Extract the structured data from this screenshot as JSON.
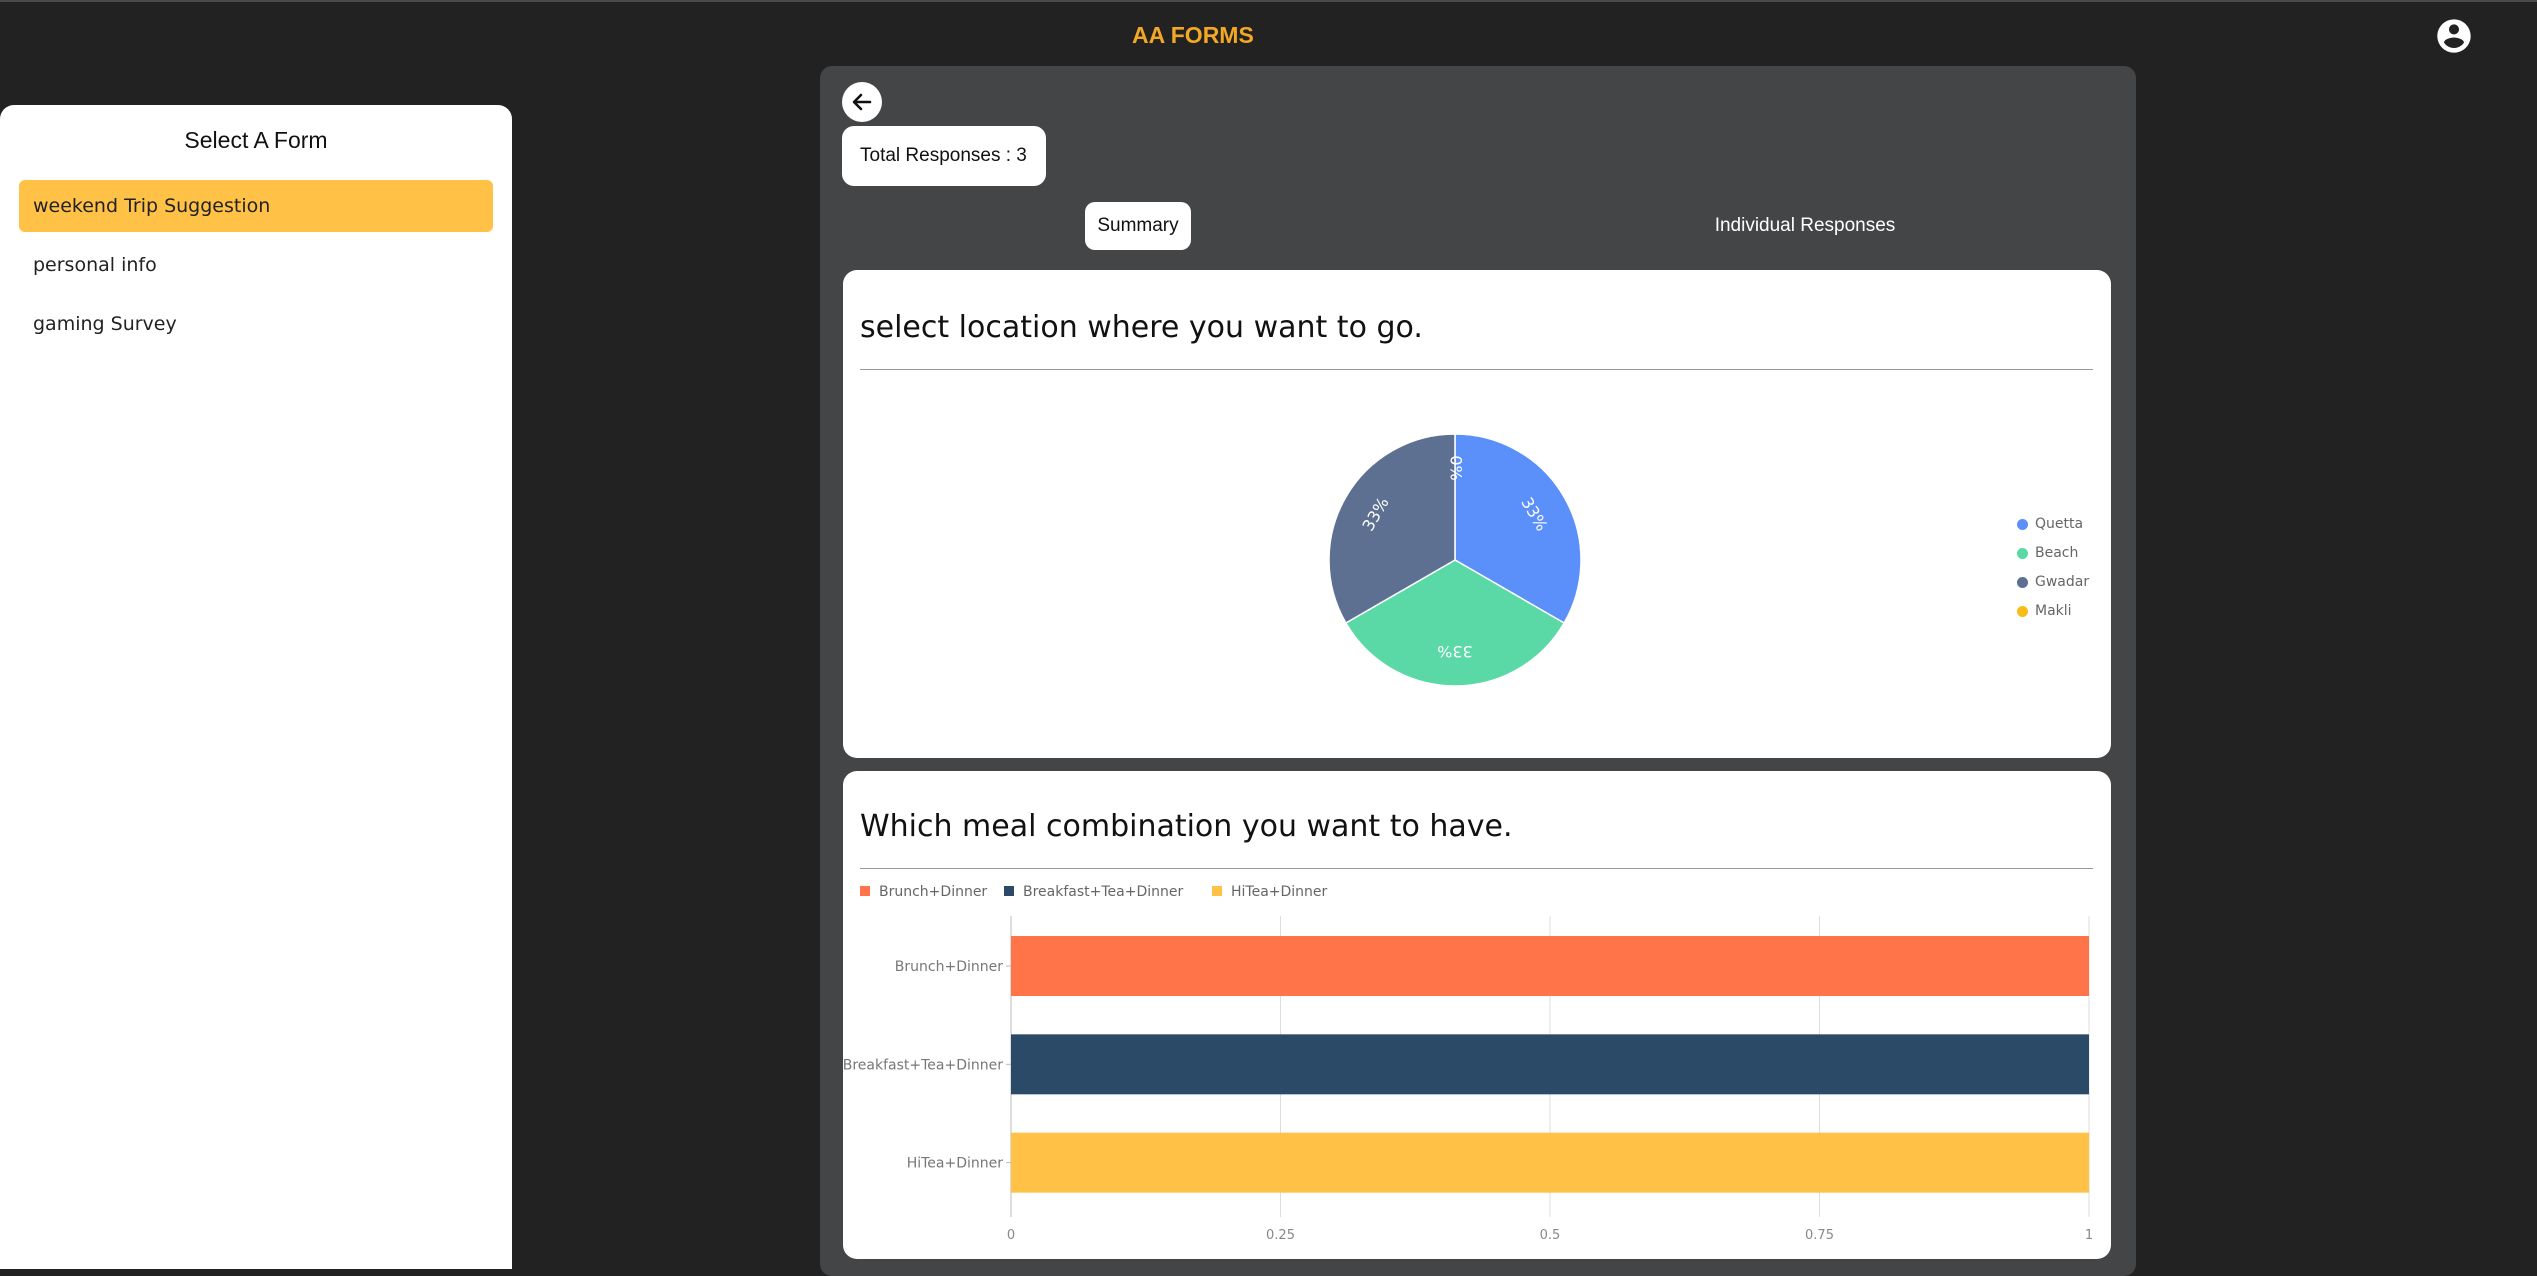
{
  "app": {
    "title": "AA FORMS"
  },
  "sidebar": {
    "title": "Select A Form",
    "items": [
      {
        "label": "weekend Trip Suggestion",
        "active": true
      },
      {
        "label": "personal info",
        "active": false
      },
      {
        "label": "gaming Survey",
        "active": false
      }
    ]
  },
  "main": {
    "total_responses": "Total Responses : 3",
    "tabs": [
      {
        "label": "Summary",
        "active": true
      },
      {
        "label": "Individual Responses",
        "active": false
      }
    ],
    "questions": [
      {
        "text": "select location where you want to go."
      },
      {
        "text": "Which meal combination you want to have."
      }
    ]
  },
  "icons": {
    "account": "account-circle-icon",
    "back": "arrow-left-icon"
  },
  "colors": {
    "brand": "#f2a825",
    "active_item": "#ffc247"
  },
  "chart_data": [
    {
      "type": "pie",
      "labels": [
        "Quetta",
        "Beach",
        "Gwadar",
        "Makli"
      ],
      "values": [
        1,
        1,
        1,
        0
      ],
      "data_labels": [
        "33%",
        "33%",
        "33%",
        "0%"
      ],
      "colors": [
        "#5b8ff9",
        "#5ad8a6",
        "#5d7092",
        "#f6bd16"
      ],
      "legend": "right"
    },
    {
      "type": "bar",
      "orientation": "horizontal",
      "categories": [
        "Brunch+Dinner",
        "Breakfast+Tea+Dinner",
        "HiTea+Dinner"
      ],
      "values": [
        1,
        1,
        1
      ],
      "colors": [
        "#ff7449",
        "#2a4a68",
        "#ffc247"
      ],
      "xlim": [
        0,
        1
      ],
      "xticks": [
        "0",
        "0.25",
        "0.5",
        "0.75",
        "1"
      ],
      "legend": "top-left",
      "grid": true
    }
  ]
}
